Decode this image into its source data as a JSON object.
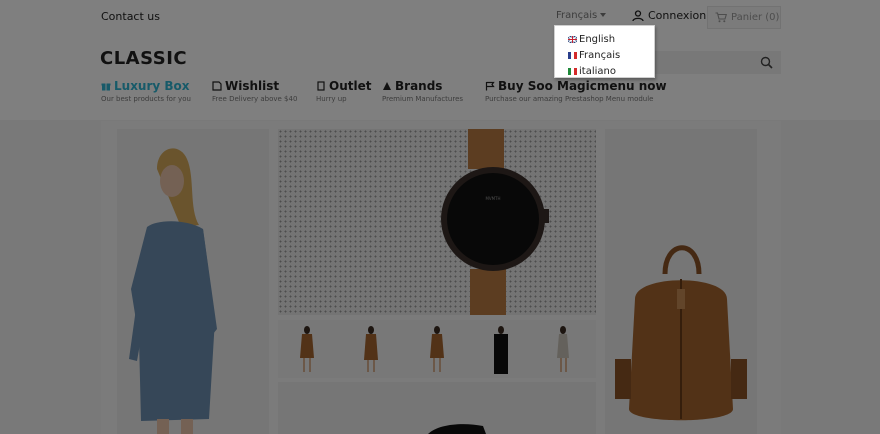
{
  "topbar": {
    "contact_label": "Contact us",
    "current_language": "Français",
    "login_label": "Connexion",
    "cart_label": "Panier (0)"
  },
  "header": {
    "logo_text": "CLASSIC",
    "search_placeholder": ""
  },
  "menu": [
    {
      "icon": "gift-icon",
      "title": "Luxury Box",
      "subtitle": "Our best products for you"
    },
    {
      "icon": "wishlist-icon",
      "title": "Wishlist",
      "subtitle": "Free Delivery above $40"
    },
    {
      "icon": "outlet-icon",
      "title": "Outlet",
      "subtitle": "Hurry up"
    },
    {
      "icon": "brands-icon",
      "title": "Brands",
      "subtitle": "Premium Manufactures"
    },
    {
      "icon": "flag-icon",
      "title": "Buy Soo Magicmenu now",
      "subtitle": "Purchase our amazing Prestashop Menu module"
    }
  ],
  "language_dropdown": {
    "options": [
      {
        "label": "English",
        "flag": "uk-flag-icon"
      },
      {
        "label": "Français",
        "flag": "fr-flag-icon"
      },
      {
        "label": "italiano",
        "flag": "it-flag-icon"
      }
    ]
  },
  "colors": {
    "accent": "#2fb5d2",
    "overlay": "rgba(0,0,0,0.5)",
    "leather": "#a5652f"
  }
}
